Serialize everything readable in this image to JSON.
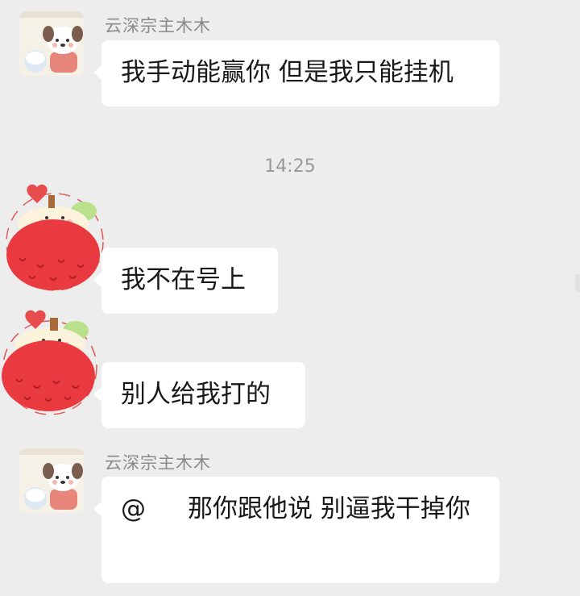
{
  "messages": [
    {
      "sender": "云深宗主木木",
      "text": "我手动能赢你 但是我只能挂机"
    },
    {
      "text": "我不在号上"
    },
    {
      "text": "别人给我打的"
    },
    {
      "sender": "云深宗主木木",
      "mention": "@",
      "text": "那你跟他说 别逼我干掉你"
    }
  ],
  "timestamp": "14:25",
  "icons": {
    "avatar_left": "dog-avatar-icon",
    "avatar_self": "apple-sticker-avatar-icon"
  }
}
